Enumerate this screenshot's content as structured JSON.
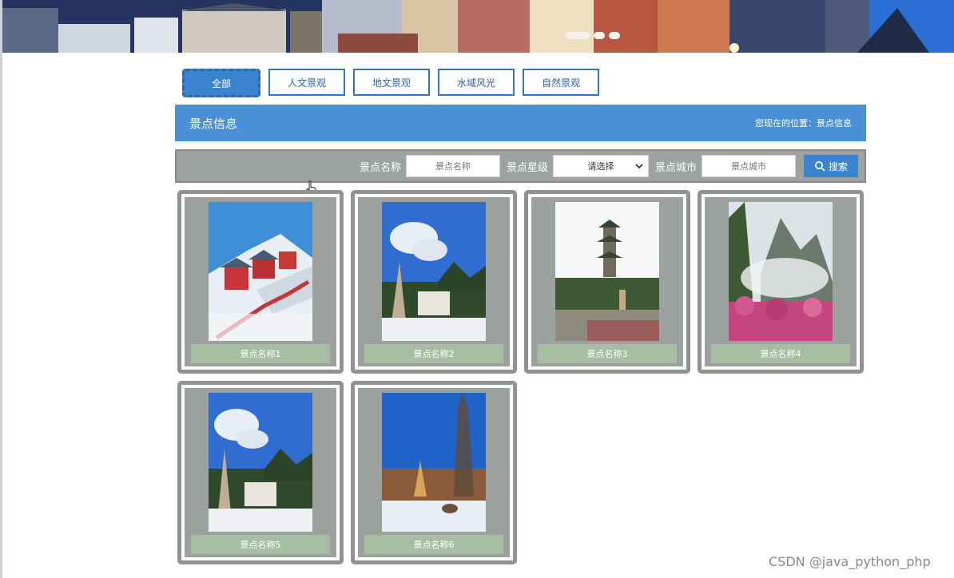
{
  "banner": {
    "slide_count": 3
  },
  "tabs": [
    {
      "label": "全部",
      "active": true
    },
    {
      "label": "人文景观",
      "active": false
    },
    {
      "label": "地文景观",
      "active": false
    },
    {
      "label": "水域风光",
      "active": false
    },
    {
      "label": "自然景观",
      "active": false
    }
  ],
  "info": {
    "title": "景点信息",
    "location": "您现在的位置：景点信息"
  },
  "search": {
    "name_label": "景点名称",
    "name_placeholder": "景点名称",
    "star_label": "景点星级",
    "star_selected": "请选择",
    "city_label": "景点城市",
    "city_placeholder": "景点城市",
    "button_label": "搜索"
  },
  "attractions": [
    {
      "name": "景点名称1",
      "image": "snow-temple-photo"
    },
    {
      "name": "景点名称2",
      "image": "stone-monument-photo"
    },
    {
      "name": "景点名称3",
      "image": "pagoda-photo"
    },
    {
      "name": "景点名称4",
      "image": "misty-mountain-photo"
    },
    {
      "name": "景点名称5",
      "image": "stone-monument-photo"
    },
    {
      "name": "景点名称6",
      "image": "winter-park-photo"
    }
  ],
  "watermark": "CSDN @java_python_php",
  "colors": {
    "primary": "#4a90d6",
    "tab_border": "#2f78c4",
    "search_bar": "#9ea3a0",
    "card_caption": "#a6bfa3"
  }
}
